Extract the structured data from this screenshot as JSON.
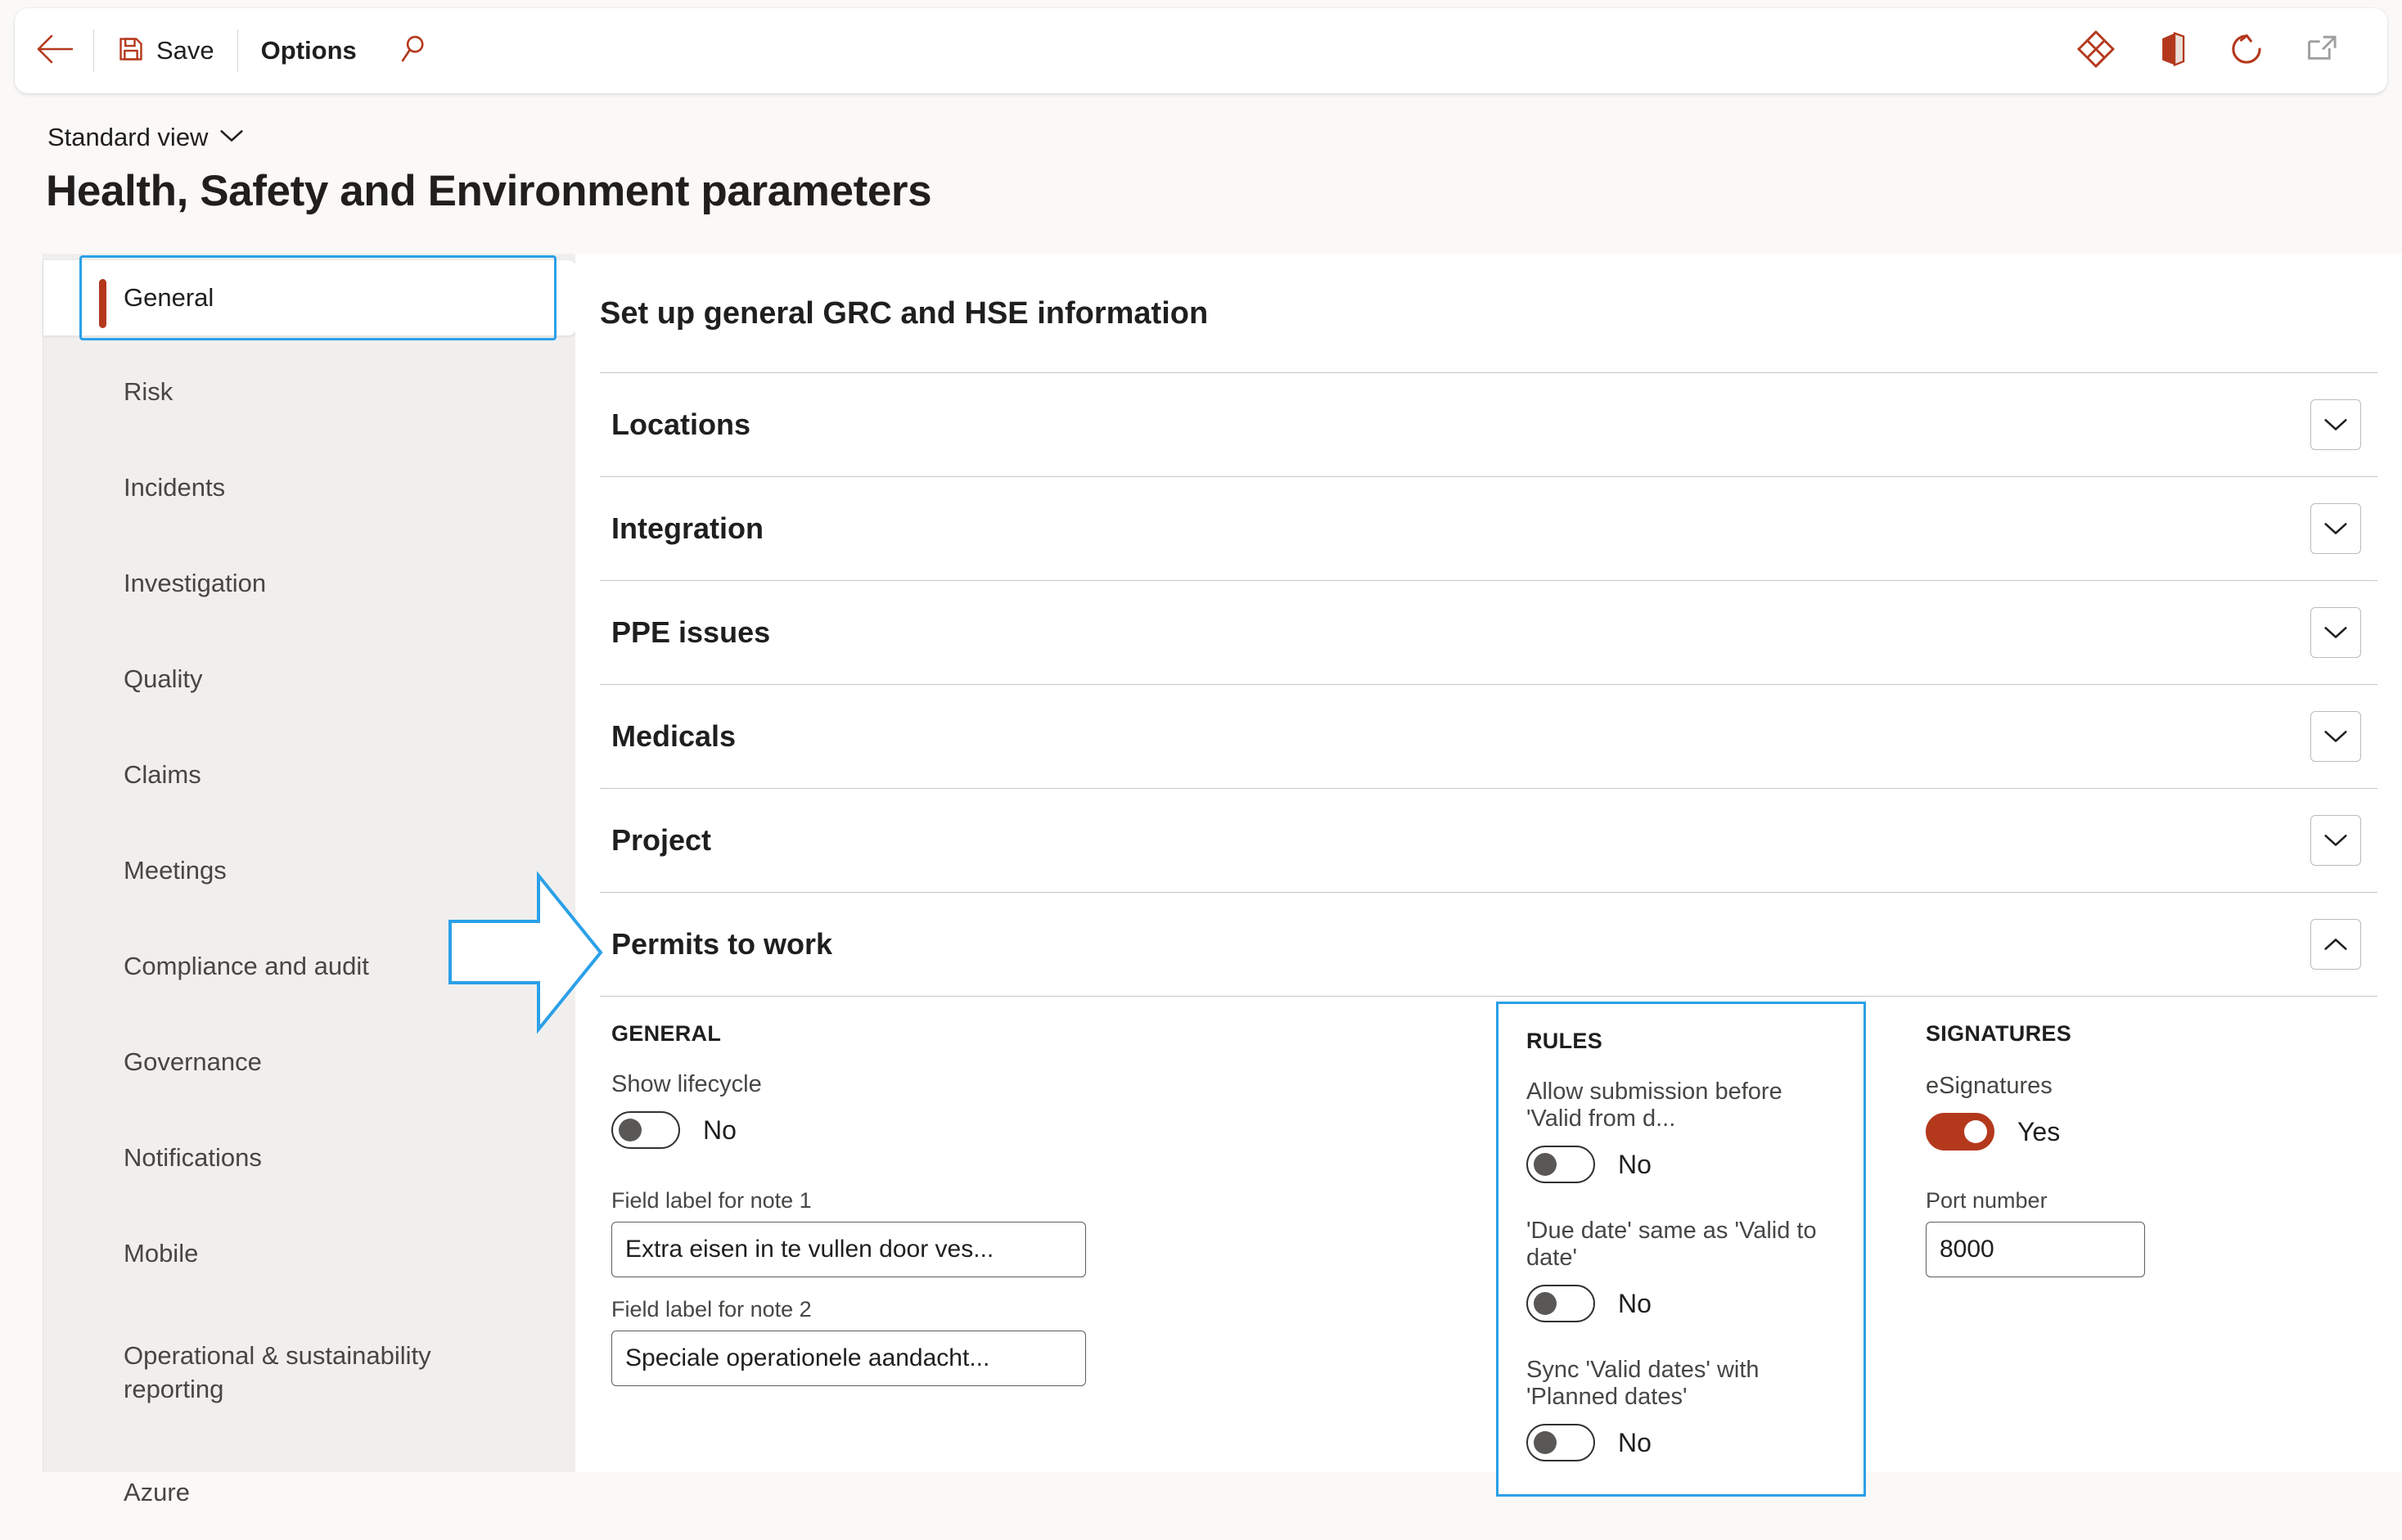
{
  "toolbar": {
    "back_icon": "back-arrow-icon",
    "save_icon": "save-disk-icon",
    "save_label": "Save",
    "options_label": "Options",
    "search_icon": "search-icon",
    "right_icons": [
      {
        "name": "dynamics-diamond-icon",
        "title": "Dynamics 365"
      },
      {
        "name": "office-icon",
        "title": "Office"
      },
      {
        "name": "refresh-icon",
        "title": "Refresh"
      },
      {
        "name": "open-in-new-window-icon",
        "title": "Open in new window"
      }
    ]
  },
  "header": {
    "view_selector_label": "Standard view",
    "view_selector_icon": "chevron-down-icon",
    "page_title": "Health, Safety and Environment parameters"
  },
  "sidebar": {
    "items": [
      {
        "label": "General",
        "selected": true
      },
      {
        "label": "Risk",
        "selected": false
      },
      {
        "label": "Incidents",
        "selected": false
      },
      {
        "label": "Investigation",
        "selected": false
      },
      {
        "label": "Quality",
        "selected": false
      },
      {
        "label": "Claims",
        "selected": false
      },
      {
        "label": "Meetings",
        "selected": false
      },
      {
        "label": "Compliance and audit",
        "selected": false
      },
      {
        "label": "Governance",
        "selected": false
      },
      {
        "label": "Notifications",
        "selected": false
      },
      {
        "label": "Mobile",
        "selected": false
      },
      {
        "label": "Operational & sustainability reporting",
        "selected": false
      },
      {
        "label": "Azure",
        "selected": false
      }
    ]
  },
  "main": {
    "title": "Set up general GRC and HSE information",
    "sections": [
      {
        "label": "Locations",
        "expanded": false,
        "chevron": "chevron-down-icon"
      },
      {
        "label": "Integration",
        "expanded": false,
        "chevron": "chevron-down-icon"
      },
      {
        "label": "PPE issues",
        "expanded": false,
        "chevron": "chevron-down-icon"
      },
      {
        "label": "Medicals",
        "expanded": false,
        "chevron": "chevron-down-icon"
      },
      {
        "label": "Project",
        "expanded": false,
        "chevron": "chevron-down-icon"
      },
      {
        "label": "Permits to work",
        "expanded": true,
        "chevron": "chevron-up-icon"
      }
    ]
  },
  "permits_to_work": {
    "general": {
      "caption": "GENERAL",
      "show_lifecycle": {
        "label": "Show lifecycle",
        "value": "No",
        "on": false
      },
      "note1": {
        "label": "Field label for note 1",
        "value": "Extra eisen in te vullen door ves..."
      },
      "note2": {
        "label": "Field label for note 2",
        "value": "Speciale operationele aandacht..."
      }
    },
    "rules": {
      "caption": "RULES",
      "toggles": [
        {
          "label": "Allow submission before 'Valid from d...",
          "value": "No",
          "on": false
        },
        {
          "label": "'Due date' same as 'Valid to date'",
          "value": "No",
          "on": false
        },
        {
          "label": "Sync 'Valid dates' with 'Planned dates'",
          "value": "No",
          "on": false
        }
      ]
    },
    "signatures": {
      "caption": "SIGNATURES",
      "esignatures": {
        "label": "eSignatures",
        "value": "Yes",
        "on": true
      },
      "port_number": {
        "label": "Port number",
        "value": "8000"
      }
    }
  },
  "annotation": {
    "arrow_icon": "right-arrow-annotation-icon",
    "points_to": "Permits to work"
  },
  "colors": {
    "accent": "#B4381C",
    "focus": "#2BA0E8",
    "page_bg": "#FAF9F8",
    "nav_bg": "#F0EFEE",
    "content_bg": "#FFFFFF",
    "text": "#201F1E",
    "muted_text": "#484644"
  }
}
